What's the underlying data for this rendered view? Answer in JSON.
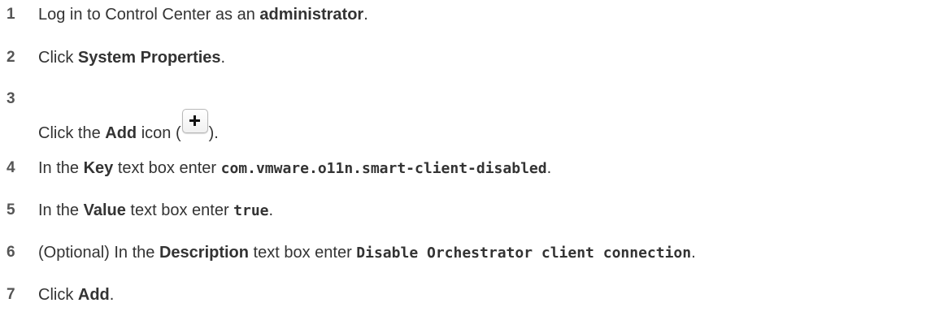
{
  "steps": [
    {
      "number": "1",
      "parts": {
        "a": "Log in to Control Center as an ",
        "b": "administrator",
        "c": "."
      }
    },
    {
      "number": "2",
      "parts": {
        "a": "Click ",
        "b": "System Properties",
        "c": "."
      }
    },
    {
      "number": "3",
      "parts": {
        "a": "Click the ",
        "b": "Add",
        "c": " icon (",
        "d": ")."
      },
      "icon": "plus-icon"
    },
    {
      "number": "4",
      "parts": {
        "a": "In the ",
        "b": "Key",
        "c": " text box enter ",
        "d": "com.vmware.o11n.smart-client-disabled",
        "e": "."
      }
    },
    {
      "number": "5",
      "parts": {
        "a": "In the ",
        "b": "Value",
        "c": " text box enter ",
        "d": "true",
        "e": "."
      }
    },
    {
      "number": "6",
      "parts": {
        "a": "(Optional) In the ",
        "b": "Description",
        "c": " text box enter ",
        "d": "Disable Orchestrator client connection",
        "e": "."
      }
    },
    {
      "number": "7",
      "parts": {
        "a": "Click ",
        "b": "Add",
        "c": "."
      }
    }
  ]
}
